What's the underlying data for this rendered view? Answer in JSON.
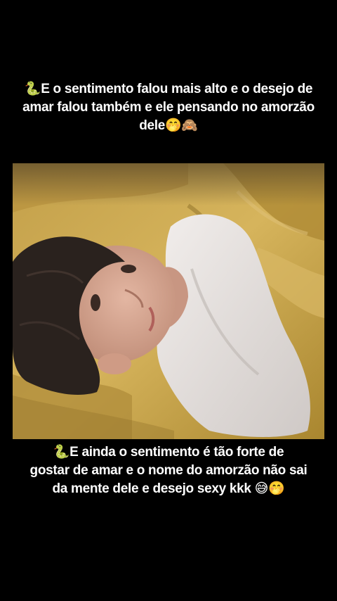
{
  "caption_top": {
    "lines": [
      "🐍E o sentimento falou mais alto e o desejo de",
      "amar falou também e ele pensando no amorzão",
      "dele🤭🙈"
    ]
  },
  "caption_bottom": {
    "lines": [
      "🐍E ainda o sentimento é tão forte de",
      "gostar de amar e o nome do amorzão não sai",
      "da mente dele e desejo sexy kkk 😅🤭"
    ]
  },
  "photo": {
    "subject": "young-man-lying-in-bed",
    "colors": {
      "bedding": "#c9a44c",
      "bedding_shadow": "#8e6f28",
      "shirt": "#e6e2e0",
      "skin": "#d9a893",
      "hair": "#2a221e",
      "background": "#000000"
    }
  }
}
